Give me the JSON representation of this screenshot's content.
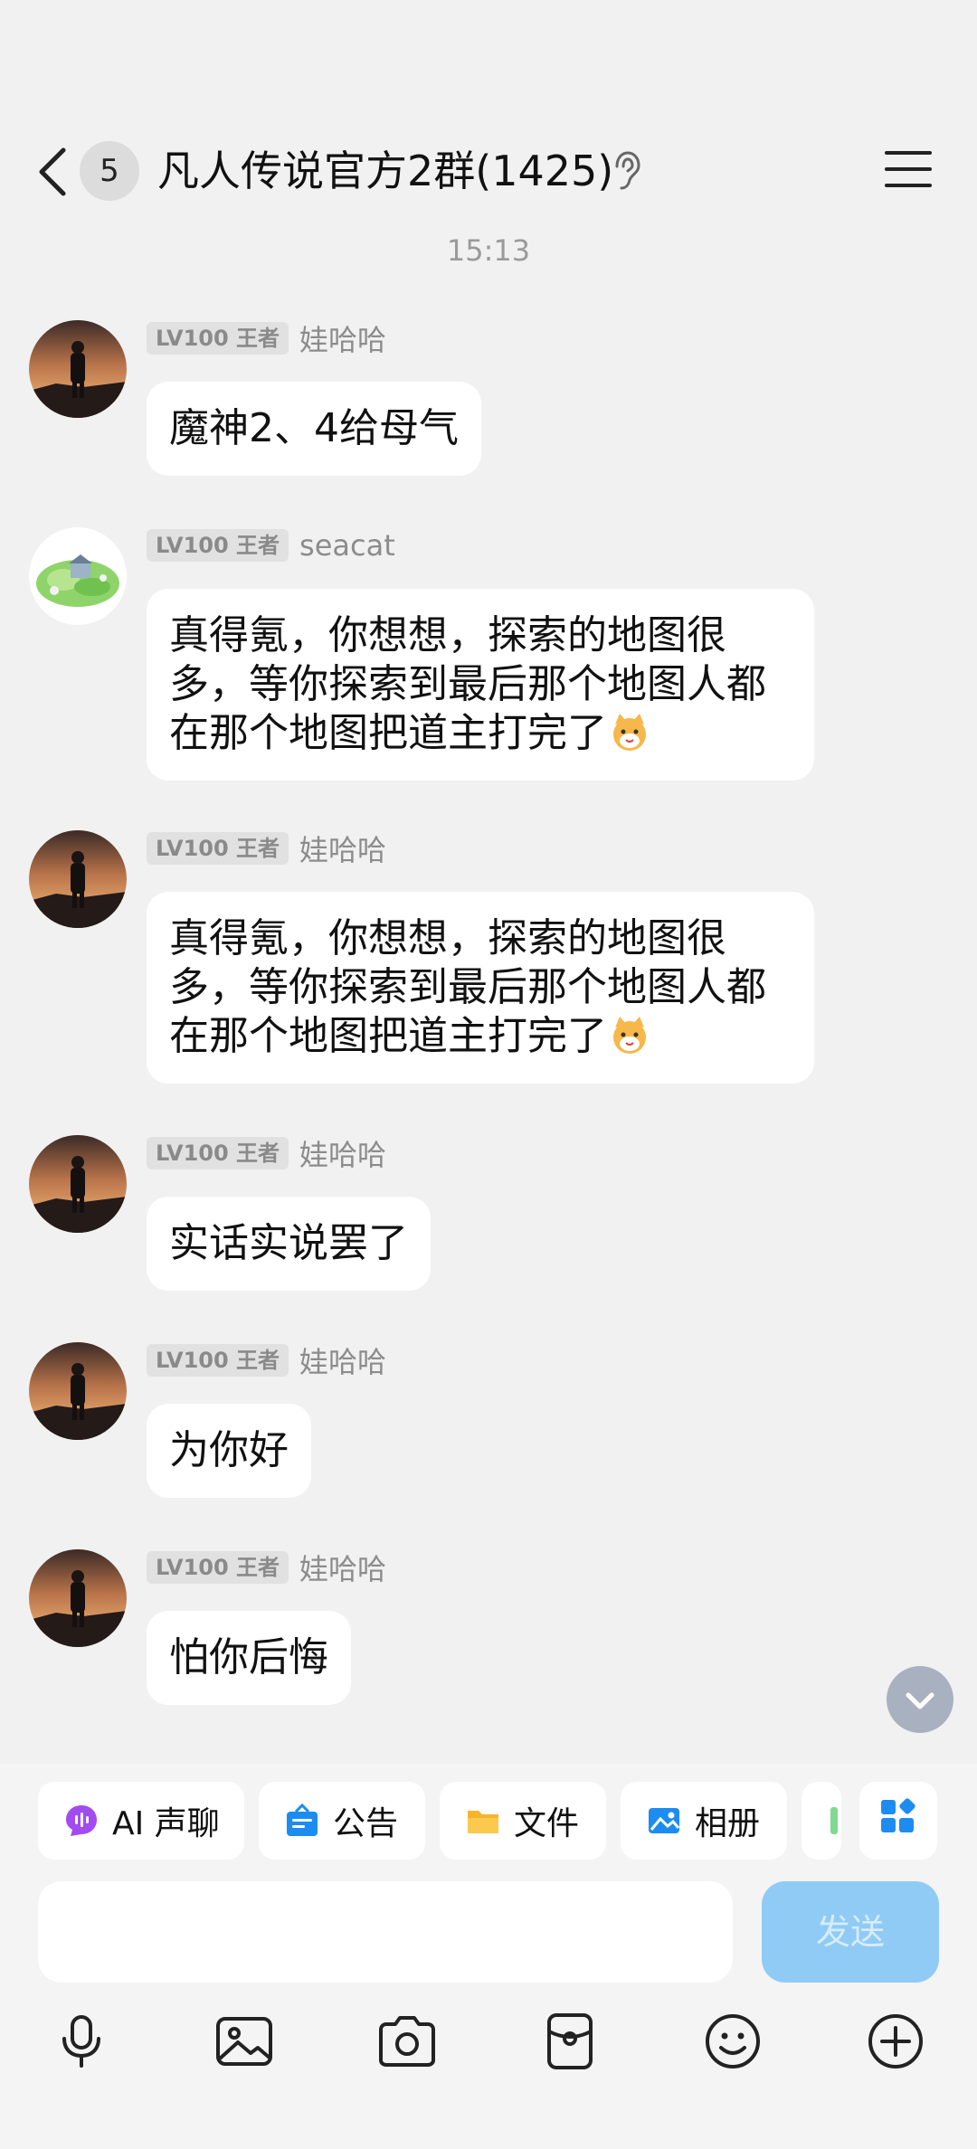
{
  "header": {
    "unread_count": "5",
    "title": "凡人传说官方2群(1425)"
  },
  "timestamp": "15:13",
  "messages": [
    {
      "level": "LV100 王者",
      "sender": "娃哈哈",
      "text": "魔神2、4给母气"
    },
    {
      "level": "LV100 王者",
      "sender": "seacat",
      "text": "真得氪，你想想，探索的地图很多，等你探索到最后那个地图人都在那个地图把道主打完了"
    },
    {
      "level": "LV100 王者",
      "sender": "娃哈哈",
      "text": "真得氪，你想想，探索的地图很多，等你探索到最后那个地图人都在那个地图把道主打完了"
    },
    {
      "level": "LV100 王者",
      "sender": "娃哈哈",
      "text": "实话实说罢了"
    },
    {
      "level": "LV100 王者",
      "sender": "娃哈哈",
      "text": "为你好"
    },
    {
      "level": "LV100 王者",
      "sender": "娃哈哈",
      "text": "怕你后悔"
    }
  ],
  "toolbar": {
    "quick_actions": [
      {
        "label": "AI 声聊",
        "icon": "ai-voice-icon",
        "color": "#a24cf0"
      },
      {
        "label": "公告",
        "icon": "announcement-icon",
        "color": "#1d8cf0"
      },
      {
        "label": "文件",
        "icon": "folder-icon",
        "color": "#f6b52b"
      },
      {
        "label": "相册",
        "icon": "album-icon",
        "color": "#1d8cf0"
      }
    ],
    "send_label": "发送",
    "input_placeholder": "",
    "bottom_icons": [
      "microphone-icon",
      "image-icon",
      "camera-icon",
      "red-packet-icon",
      "emoji-icon",
      "plus-icon"
    ]
  },
  "colors": {
    "background": "#f1f1f1",
    "bubble": "#ffffff",
    "send_button": "#8fcbf5",
    "accent_blue": "#1d8cf0"
  }
}
